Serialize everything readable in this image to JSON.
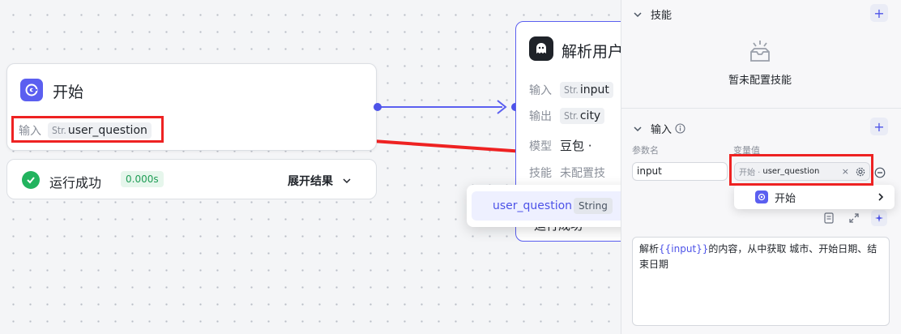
{
  "start_node": {
    "title": "开始",
    "input_label": "输入",
    "input_type": "Str.",
    "input_name": "user_question"
  },
  "run_result": {
    "status": "运行成功",
    "time": "0.000s",
    "expand": "展开结果"
  },
  "llm_node": {
    "title": "解析用户",
    "rows": [
      {
        "label": "输入",
        "type": "Str.",
        "value": "input"
      },
      {
        "label": "输出",
        "type": "Str.",
        "value": "city"
      },
      {
        "label": "模型",
        "value": "豆包 · "
      },
      {
        "label": "技能",
        "value": "未配置技"
      }
    ],
    "status_partial": "运行成功"
  },
  "dropdown": {
    "item_name": "user_question",
    "item_type": "String"
  },
  "panel": {
    "skills_title": "技能",
    "skills_empty": "暂未配置技能",
    "input_title": "输入",
    "col_param": "参数名",
    "col_value": "变量值",
    "param_value": "input",
    "ref_prefix": "开始 ·",
    "ref_var": "user_question",
    "cascade_item": "开始",
    "prompt_before": "解析",
    "prompt_var": "{{input}}",
    "prompt_after": "的内容，从中获取 城市、开始日期、结束日期"
  },
  "colors": {
    "accent": "#4d53e8",
    "success": "#22b35e",
    "annotation": "#ee2222"
  },
  "icons": [
    "start-icon",
    "llm-ghost-icon",
    "check-icon",
    "chevron-down-icon",
    "chevron-right-icon",
    "plus-icon",
    "info-icon",
    "empty-box-icon",
    "close-icon",
    "settings-icon",
    "minus-circle-icon",
    "document-icon",
    "expand-icon",
    "magic-icon"
  ]
}
